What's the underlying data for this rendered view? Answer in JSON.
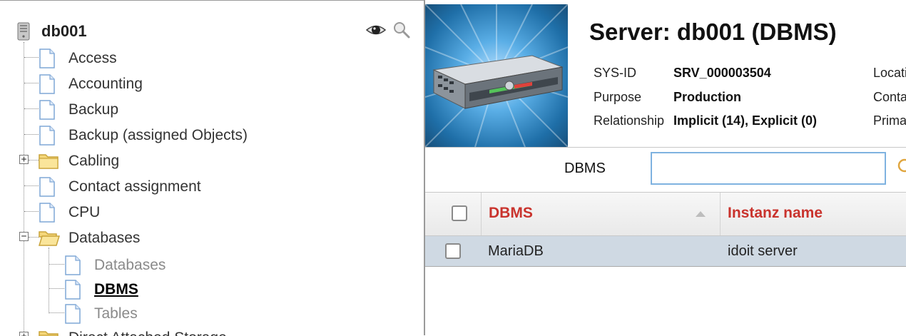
{
  "tree": {
    "title": "db001",
    "nodes": [
      {
        "label": "Access"
      },
      {
        "label": "Accounting"
      },
      {
        "label": "Backup"
      },
      {
        "label": "Backup (assigned Objects)"
      },
      {
        "label": "Cabling",
        "expander": "+"
      },
      {
        "label": "Contact assignment"
      },
      {
        "label": "CPU"
      },
      {
        "label": "Databases",
        "expander": "−"
      },
      {
        "label": "Databases"
      },
      {
        "label": "DBMS"
      },
      {
        "label": "Tables"
      },
      {
        "label": "Direct Attached Storage"
      }
    ]
  },
  "header": {
    "title": "Server: db001 (DBMS)",
    "fields": [
      {
        "label": "SYS-ID",
        "value": "SRV_000003504",
        "right_label": "Locati"
      },
      {
        "label": "Purpose",
        "value": "Production",
        "right_label": "Conta"
      },
      {
        "label": "Relationship",
        "value": "Implicit (14), Explicit (0)",
        "right_label": "Prima"
      }
    ]
  },
  "filter": {
    "label": "DBMS",
    "value": ""
  },
  "table": {
    "columns": [
      "DBMS",
      "Instanz name"
    ],
    "rows": [
      [
        "MariaDB",
        "idoit server"
      ]
    ]
  },
  "colors": {
    "column_header": "#c9332d",
    "row_selected": "#cfd9e3",
    "input_border": "#7fb2e0"
  }
}
